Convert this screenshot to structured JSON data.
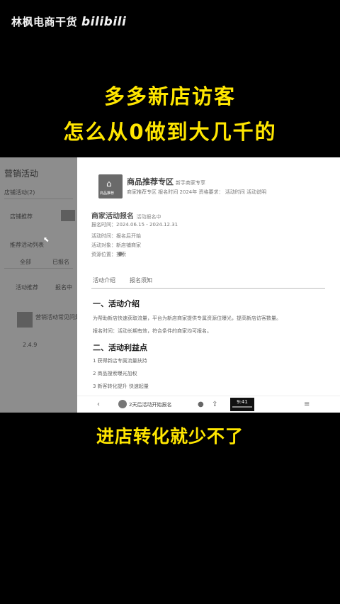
{
  "watermark": {
    "channel": "林枫电商干货",
    "platform": "bilibili"
  },
  "headline": {
    "line1": "多多新店访客",
    "line2": "怎么从0做到大几千的"
  },
  "screen": {
    "left": {
      "title": "营销活动",
      "rows": [
        "店铺活动(2)",
        "店铺推荐",
        "推荐活动列表",
        "全部",
        "已报名",
        "活动推荐",
        "报名中",
        "营销活动常见问题",
        "2.4.9"
      ]
    },
    "right": {
      "shop_name": "商品推荐专区",
      "shop_sub": "新手商家专享",
      "logo_label": "商品推荐",
      "intro": "商家推荐专区   报名时间 2024年  资格要求：     活动时间     活动说明",
      "activity_title": "商家活动报名",
      "activity_sub": "活动报名中",
      "activity_dates": "报名时间：2024.06.15 - 2024.12.31",
      "meta": [
        "活动时间：报名后开始",
        "活动对象：新店铺商家",
        "资源位置：搜索"
      ],
      "tab1": "活动介绍",
      "tab2": "报名须知",
      "section1": "一、活动介绍",
      "body1": "为帮助新店快速获取流量，平台为新店商家提供专属资源位曝光，提高新店访客数量。",
      "body2": "报名时间：活动长期有效，符合条件的商家均可报名。",
      "section2": "二、活动利益点",
      "benefits": [
        "1  获得新店专属流量扶持",
        "2  商品搜索曝光加权",
        "3  新客转化提升 快速起量"
      ]
    },
    "toolbar": {
      "message": "2天后活动开始报名",
      "time": "9:41"
    }
  },
  "caption": "进店转化就少不了"
}
